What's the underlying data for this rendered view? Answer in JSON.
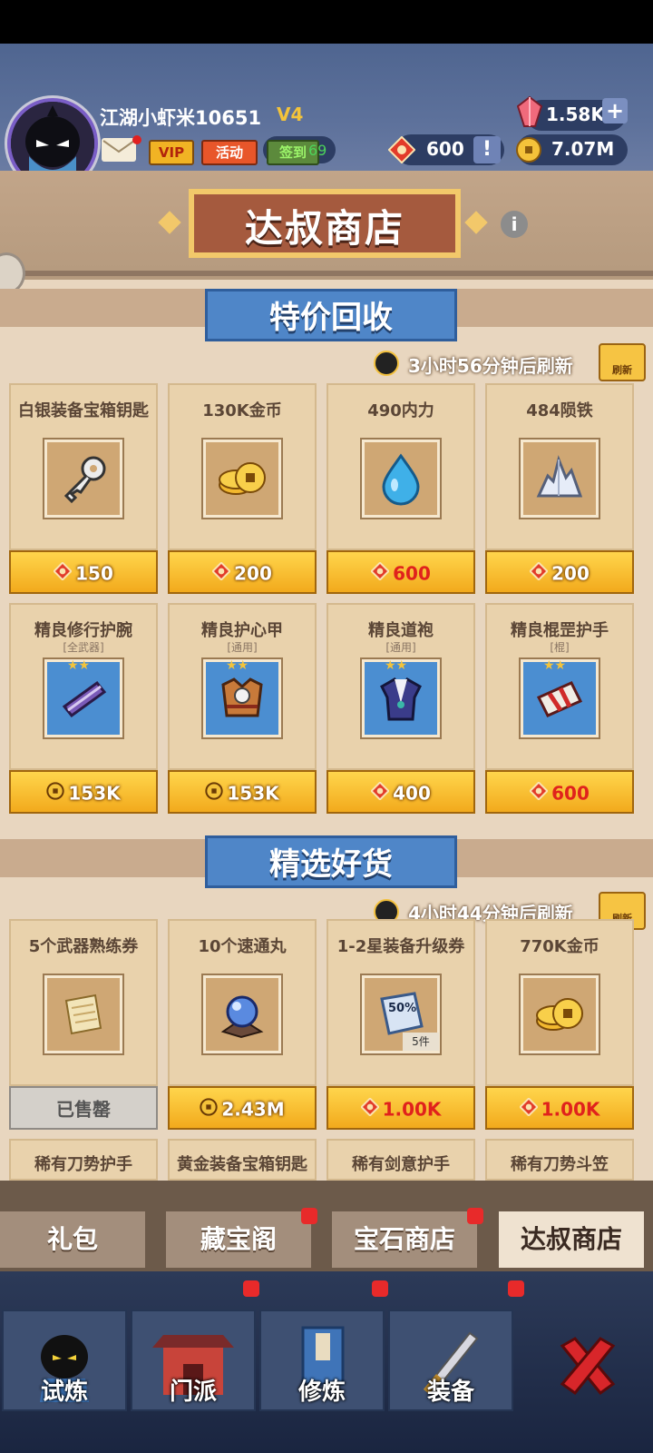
{
  "player": {
    "name": "江湖小虾米10651",
    "vip_level": "V4",
    "signin_count": "69"
  },
  "header_buttons": {
    "vip": "VIP",
    "event": "活动",
    "signin": "签到"
  },
  "resources": {
    "gems": "1.58K",
    "tokens": "600",
    "coins": "7.07M"
  },
  "shop_title": "达叔商店",
  "sections": [
    {
      "title": "特价回收",
      "timer": "3小时56分钟后刷新",
      "refresh_label": "刷新",
      "items": [
        {
          "name": "白银装备宝箱钥匙",
          "sub": "",
          "price": "150",
          "currency": "token-icon",
          "price_red": false,
          "icon": "key-icon"
        },
        {
          "name": "130K金币",
          "sub": "",
          "price": "200",
          "currency": "token-icon",
          "price_red": false,
          "icon": "coins-icon"
        },
        {
          "name": "490内力",
          "sub": "",
          "price": "600",
          "currency": "token-icon",
          "price_red": true,
          "icon": "water-drop-icon"
        },
        {
          "name": "484陨铁",
          "sub": "",
          "price": "200",
          "currency": "token-icon",
          "price_red": false,
          "icon": "crystal-ore-icon"
        },
        {
          "name": "精良修行护腕",
          "sub": "[全武器]",
          "price": "153K",
          "currency": "coin-icon",
          "price_red": false,
          "icon": "bracer-icon"
        },
        {
          "name": "精良护心甲",
          "sub": "[通用]",
          "price": "153K",
          "currency": "coin-icon",
          "price_red": false,
          "icon": "chest-armor-icon"
        },
        {
          "name": "精良道袍",
          "sub": "[通用]",
          "price": "400",
          "currency": "token-icon",
          "price_red": false,
          "icon": "robe-icon"
        },
        {
          "name": "精良棍罡护手",
          "sub": "[棍]",
          "price": "600",
          "currency": "token-icon",
          "price_red": true,
          "icon": "gauntlet-icon"
        }
      ]
    },
    {
      "title": "精选好货",
      "timer": "4小时44分钟后刷新",
      "refresh_label": "刷新",
      "items": [
        {
          "name": "5个武器熟练券",
          "sub": "",
          "price": "已售罄",
          "currency": "",
          "price_red": false,
          "sold": true,
          "icon": "scroll-icon"
        },
        {
          "name": "10个速通丸",
          "sub": "",
          "price": "2.43M",
          "currency": "coin-icon",
          "price_red": false,
          "icon": "orb-icon"
        },
        {
          "name": "1-2星装备升级券",
          "sub": "",
          "price": "1.00K",
          "currency": "token-icon",
          "price_red": true,
          "icon": "upgrade-ticket-icon",
          "badge": "5件",
          "ticket_text": "50%"
        },
        {
          "name": "770K金币",
          "sub": "",
          "price": "1.00K",
          "currency": "token-icon",
          "price_red": true,
          "icon": "coins-icon"
        }
      ],
      "partial_items": [
        "稀有刀势护手",
        "黄金装备宝箱钥匙",
        "稀有剑意护手",
        "稀有刀势斗笠"
      ]
    }
  ],
  "shop_tabs": [
    "礼包",
    "藏宝阁",
    "宝石商店",
    "达叔商店"
  ],
  "bottom_nav": [
    "试炼",
    "门派",
    "修炼",
    "装备"
  ],
  "colors": {
    "accent_gold": "#f2c86a",
    "section_blue": "#4f86c8",
    "price_red": "#e0221c"
  }
}
